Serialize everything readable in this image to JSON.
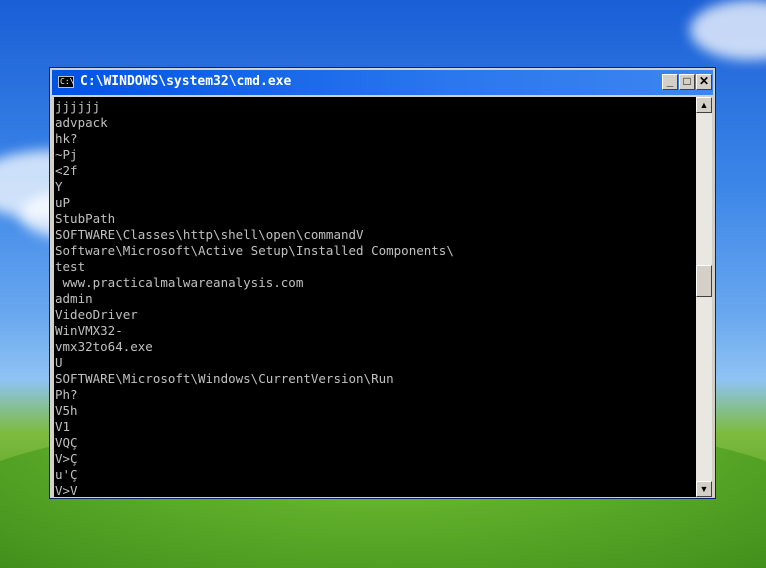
{
  "window": {
    "title": "C:\\WINDOWS\\system32\\cmd.exe",
    "icon_text": "C:\\",
    "buttons": {
      "minimize": "_",
      "maximize": "□",
      "close": "✕"
    }
  },
  "console": {
    "lines": [
      "jjjjjj",
      "advpack",
      "hk?",
      "~Pj",
      "<2f",
      "Y",
      "uP",
      "StubPath",
      "SOFTWARE\\Classes\\http\\shell\\open\\commandV",
      "Software\\Microsoft\\Active Setup\\Installed Components\\",
      "test",
      " www.practicalmalwareanalysis.com",
      "admin",
      "VideoDriver",
      "WinVMX32-",
      "vmx32to64.exe",
      "U",
      "SOFTWARE\\Microsoft\\Windows\\CurrentVersion\\Run",
      "Ph?",
      "V5h",
      "V1",
      "VQÇ",
      "V>Ç",
      "u'Ç",
      "V>V"
    ]
  },
  "scrollbar": {
    "up_arrow": "▲",
    "down_arrow": "▼"
  }
}
